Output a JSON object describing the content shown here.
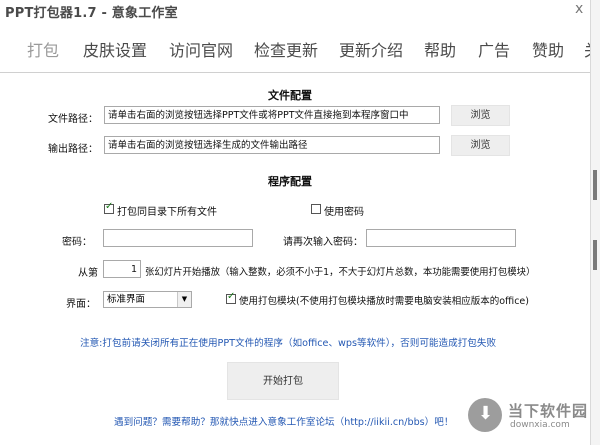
{
  "window": {
    "title": "PPT打包器1.7 - 意象工作室",
    "close_glyph": "x"
  },
  "menu": [
    {
      "label": "打包"
    },
    {
      "label": "皮肤设置"
    },
    {
      "label": "访问官网"
    },
    {
      "label": "检查更新"
    },
    {
      "label": "更新介绍"
    },
    {
      "label": "帮助"
    },
    {
      "label": "广告"
    },
    {
      "label": "赞助"
    },
    {
      "label": "关"
    }
  ],
  "file_config": {
    "section_title": "文件配置",
    "file_path_label": "文件路径：",
    "file_path_value": "请单击右面的浏览按钮选择PPT文件或将PPT文件直接拖到本程序窗口中",
    "browse_label_1": "浏览",
    "output_path_label": "输出路径：",
    "output_path_value": "请单击右面的浏览按钮选择生成的文件输出路径",
    "browse_label_2": "浏览"
  },
  "program_config": {
    "section_title": "程序配置",
    "pack_all_label": "打包同目录下所有文件",
    "pack_all_checked": true,
    "use_password_label": "使用密码",
    "use_password_checked": false,
    "password_label": "密码：",
    "password_value": "",
    "repeat_password_label": "请再次输入密码：",
    "repeat_password_value": "",
    "from_label": "从第",
    "start_slide_value": "1",
    "start_slide_desc": "张幻灯片开始播放（输入整数，必须不小于1，不大于幻灯片总数，本功能需要使用打包模块）",
    "ui_label": "界面：",
    "ui_selected": "标准界面",
    "use_module_label": "使用打包模块(不使用打包模块播放时需要电脑安装相应版本的office)",
    "use_module_checked": true
  },
  "notice": "注意:打包前请关闭所有正在使用PPT文件的程序（如office、wps等软件），否则可能造成打包失败",
  "start_button": "开始打包",
  "help_link": "遇到问题？需要帮助？那就快点进入意象工作室论坛（http://iikii.cn/bbs）吧！",
  "watermark": {
    "text": "当下软件园",
    "sub": "downxia.com"
  }
}
